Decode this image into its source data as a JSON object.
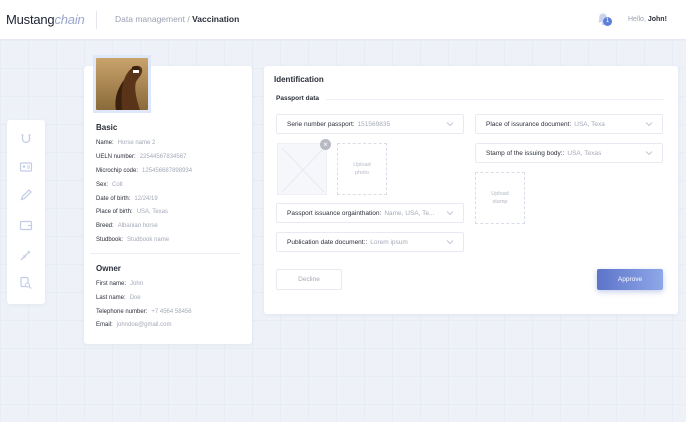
{
  "header": {
    "logo_main": "Mustang",
    "logo_accent": "chain",
    "breadcrumb_parent": "Data management",
    "breadcrumb_sep": "/",
    "breadcrumb_current": "Vaccination",
    "notification_count": "1",
    "greeting": "Hello,",
    "user_name": "John!"
  },
  "sidebar": {
    "icons": [
      "horseshoe-icon",
      "id-card-icon",
      "pencil-icon",
      "wallet-icon",
      "syringe-icon",
      "search-document-icon"
    ]
  },
  "profile": {
    "basic_title": "Basic",
    "basic": [
      {
        "label": "Name:",
        "value": "Horse name 2"
      },
      {
        "label": "UELN number:",
        "value": "22544567834567"
      },
      {
        "label": "Microchip code:",
        "value": "125456687898934"
      },
      {
        "label": "Sex:",
        "value": "Colt"
      },
      {
        "label": "Date of birth:",
        "value": "12/24/19"
      },
      {
        "label": "Place of birth:",
        "value": "USA, Texas"
      },
      {
        "label": "Breed:",
        "value": "Albanian horse"
      },
      {
        "label": "Studbook:",
        "value": "Studbook name"
      }
    ],
    "owner_title": "Owner",
    "owner": [
      {
        "label": "First name:",
        "value": "John"
      },
      {
        "label": "Last name:",
        "value": "Doe"
      },
      {
        "label": "Telephone number:",
        "value": "+7 4564 58456"
      },
      {
        "label": "Email:",
        "value": "johndoe@gmail.com"
      }
    ]
  },
  "identification": {
    "title": "Identification",
    "section": "Passport data",
    "serie_label": "Serie number passport:",
    "serie_value": "151569835",
    "place_issuance_label": "Place of issurance document:",
    "place_issuance_value": "USA, Texa",
    "stamp_label": "Stamp of the issuing body::",
    "stamp_value": "USA, Texas",
    "org_label": "Passport issuance orgainthation:",
    "org_value": "Name, USA, Te...",
    "pub_label": "Publication date document::",
    "pub_value": "Lorem ipsum",
    "upload_photo_line1": "Upload",
    "upload_photo_line2": "photo",
    "upload_stamp_line1": "Upload",
    "upload_stamp_line2": "stamp",
    "remove_glyph": "×"
  },
  "actions": {
    "decline": "Decline",
    "approve": "Approve"
  },
  "colors": {
    "accent": "#5d74c9",
    "background": "#eef1f8"
  }
}
